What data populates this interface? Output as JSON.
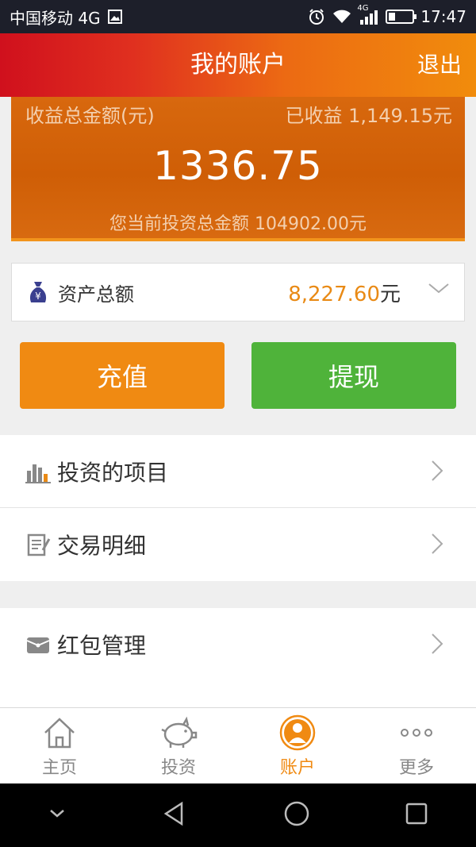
{
  "status_bar": {
    "carrier": "中国移动 4G",
    "time": "17:47",
    "network_label": "4G"
  },
  "header": {
    "title": "我的账户",
    "logout": "退出"
  },
  "earnings": {
    "total_label": "收益总金额(元)",
    "received_label": "已收益 1,149.15元",
    "total_value": "1336.75",
    "investment_text": "您当前投资总金额 104902.00元"
  },
  "assets": {
    "label": "资产总额",
    "value": "8,227.60",
    "unit": "元"
  },
  "buttons": {
    "recharge": "充值",
    "withdraw": "提现"
  },
  "menu": {
    "group1": [
      {
        "label": "投资的项目",
        "icon": "bar-chart-icon"
      },
      {
        "label": "交易明细",
        "icon": "notepad-icon"
      }
    ],
    "group2": [
      {
        "label": "红包管理",
        "icon": "red-envelope-icon"
      }
    ]
  },
  "tabs": [
    {
      "label": "主页",
      "icon": "home-icon",
      "active": false
    },
    {
      "label": "投资",
      "icon": "piggy-bank-icon",
      "active": false
    },
    {
      "label": "账户",
      "icon": "user-icon",
      "active": true
    },
    {
      "label": "更多",
      "icon": "more-dots-icon",
      "active": false
    }
  ],
  "colors": {
    "accent_orange": "#f08a12",
    "accent_green": "#4fb33a",
    "header_red": "#d0101d",
    "value_orange": "#e98a15"
  }
}
